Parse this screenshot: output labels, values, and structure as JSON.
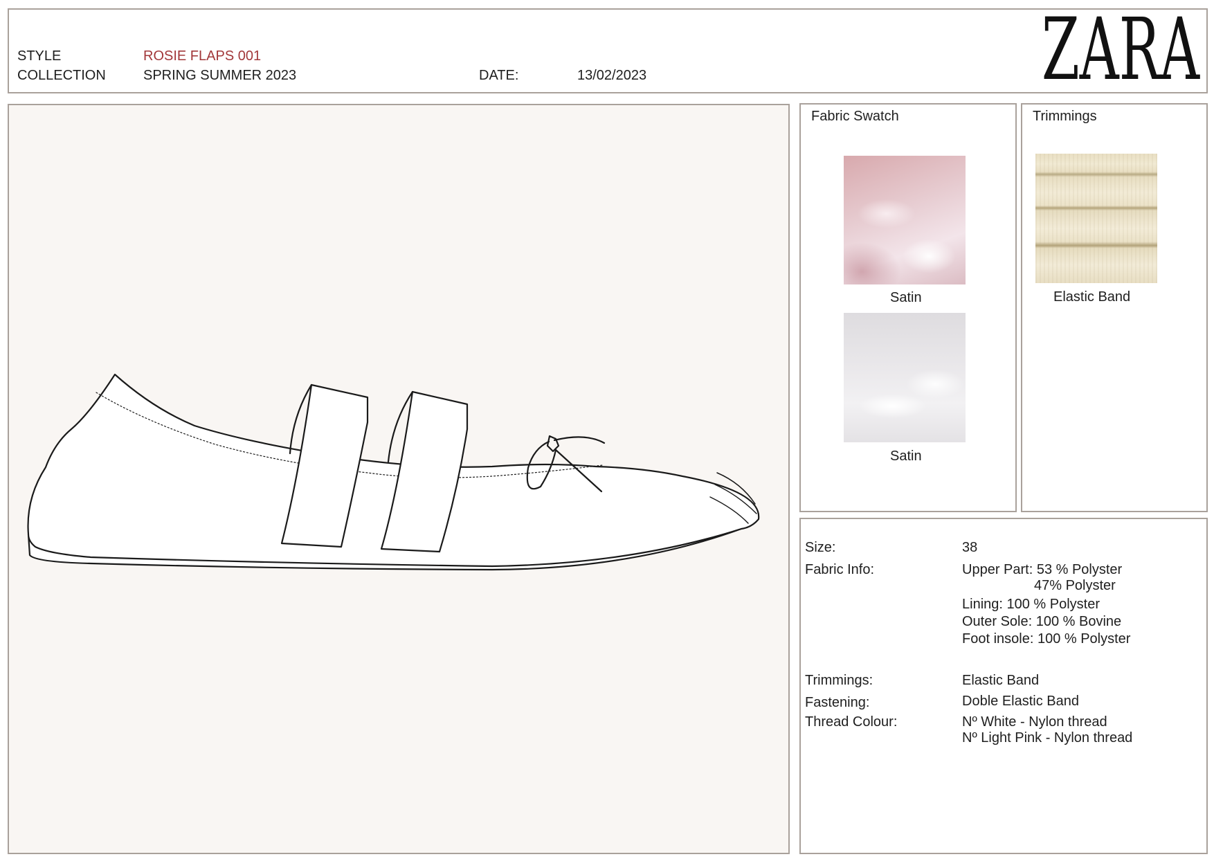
{
  "header": {
    "style_label": "STYLE",
    "style_value": "ROSIE FLAPS 001",
    "collection_label": "COLLECTION",
    "collection_value": "SPRING SUMMER 2023",
    "date_label": "DATE:",
    "date_value": "13/02/2023",
    "brand_logo": "ZARA"
  },
  "fabric_swatch": {
    "title": "Fabric Swatch",
    "items": [
      {
        "label": "Satin",
        "color": "#e6c9cd"
      },
      {
        "label": "Satin",
        "color": "#e9e7ea"
      }
    ]
  },
  "trimmings_panel": {
    "title": "Trimmings",
    "items": [
      {
        "label": "Elastic Band",
        "color": "#eee5cc"
      }
    ]
  },
  "specs": {
    "size_label": "Size:",
    "size_value": "38",
    "fabric_info_label": "Fabric Info:",
    "fabric_info_lines": [
      "Upper Part: 53 % Polyster",
      "47% Polyster",
      "Lining: 100 % Polyster",
      "Outer Sole: 100 % Bovine",
      "Foot insole: 100 % Polyster"
    ],
    "trimmings_label": "Trimmings:",
    "trimmings_value": "Elastic Band",
    "fastening_label": "Fastening:",
    "fastening_value": "Doble Elastic Band",
    "thread_colour_label": "Thread Colour:",
    "thread_colour_lines": [
      "Nº White - Nylon thread",
      "Nº Light Pink - Nylon thread"
    ]
  },
  "colors": {
    "border": "#a9a19b",
    "style_value_color": "#a2383a",
    "drawing_background": "#f9f6f3"
  },
  "icons": {
    "illustration": "ballet-flat-technical-drawing"
  }
}
